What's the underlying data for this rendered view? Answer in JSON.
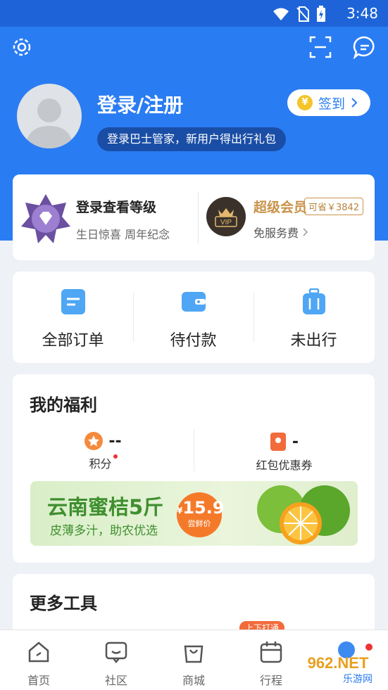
{
  "status_bar": {
    "time": "3:48"
  },
  "profile": {
    "title": "登录/注册",
    "subtitle": "登录巴士管家，新用户得出行礼包",
    "signin_label": "签到",
    "coin_symbol": "¥"
  },
  "level": {
    "title": "登录查看等级",
    "subtitle": "生日惊喜  周年纪念"
  },
  "vip": {
    "title": "超级会员",
    "save_tag": "可省￥3842",
    "subtitle": "免服务费",
    "badge_text": "VIP"
  },
  "orders": [
    {
      "label": "全部订单"
    },
    {
      "label": "待付款"
    },
    {
      "label": "未出行"
    }
  ],
  "welfare": {
    "title": "我的福利",
    "points": {
      "value": "--",
      "label": "积分"
    },
    "coupons": {
      "value": "-",
      "label": "红包优惠券"
    },
    "banner": {
      "title": "云南蜜桔5斤",
      "subtitle": "皮薄多汁，助农优选",
      "price": "15.9",
      "price_prefix": "¥",
      "price_tag": "尝鲜价"
    }
  },
  "tools": {
    "title": "更多工具",
    "tip": "上下打通"
  },
  "tabs": [
    {
      "label": "首页",
      "icon": "home-icon"
    },
    {
      "label": "社区",
      "icon": "community-icon"
    },
    {
      "label": "商城",
      "icon": "shop-icon"
    },
    {
      "label": "行程",
      "icon": "trip-icon"
    }
  ],
  "watermark": "962.NET 乐游网",
  "colors": {
    "brand_blue": "#2a7cf3",
    "vip_gold": "#c9934a",
    "banner_green": "#3f8f2f",
    "price_orange": "#f47a2a"
  }
}
